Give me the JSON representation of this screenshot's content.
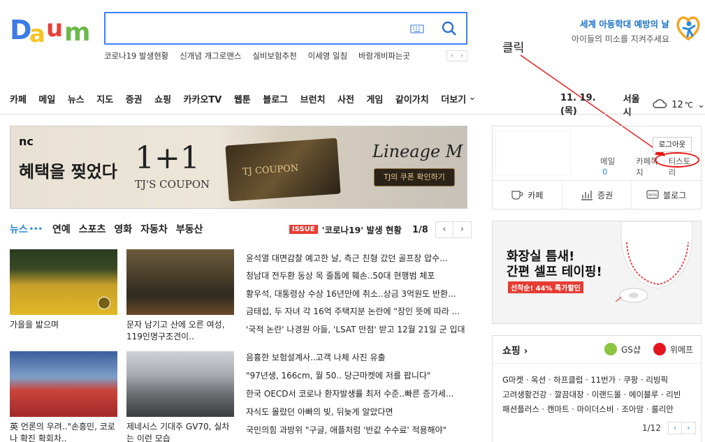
{
  "header": {
    "logo_alt": "Daum",
    "search": {
      "value": "",
      "placeholder": ""
    },
    "trending": [
      "코로나19 발생현황",
      "신개념 개그로맨스",
      "실비보험추천",
      "이세영 일침",
      "바람개비파는곳"
    ],
    "trend_prev": "‹",
    "trend_next": "›",
    "campaign": {
      "line1": "세계 아동학대 예방의 날",
      "line2": "아이들의 미소를 지켜주세요"
    }
  },
  "annotation": {
    "text": "클릭"
  },
  "nav": {
    "items": [
      "카페",
      "메일",
      "뉴스",
      "지도",
      "증권",
      "쇼핑",
      "카카오TV",
      "웹툰",
      "블로그",
      "브런치",
      "사전",
      "게임",
      "같이가치",
      "더보기"
    ],
    "date": "11. 19. (목)",
    "city": "서울시",
    "temp": "12",
    "temp_unit": "℃"
  },
  "ad": {
    "brand": "nc",
    "headline": "혜택을 찢었다",
    "big": "1+1",
    "sub": "TJ'S COUPON",
    "coupon": "TJ COUPON",
    "game": "Lineage M",
    "cta": "TJ의 쿠폰 확인하기"
  },
  "news": {
    "tabs": [
      "뉴스",
      "연예",
      "스포츠",
      "영화",
      "자동차",
      "부동산"
    ],
    "issue_badge": "ISSUE",
    "issue_text": "'코로나19' 발생 현황",
    "page": "1/8",
    "thumbs": [
      {
        "caption": "가을을 밟으며"
      },
      {
        "caption": "문자 남기고 산에 오른 여성, 119인명구조견이.."
      },
      {
        "caption": "英 언론의 우려..\"손흥민, 코로나 확진 확회차.."
      },
      {
        "caption": "제네시스 기대주 GV70, 실차는 이런 모습"
      }
    ],
    "headlines": [
      "윤석열 대면감찰 예고한 날, 측근 친형 갔던 골프장 압수...",
      "청남대 전두환 동상 목 줄톱에 훼손..50대 현행범 체포",
      "황우석, 대통령상 수상 16년만에 취소..상금 3억원도 반환...",
      "금태섭, 두 자녀 각 16억 주택지분 논란에 \"장인 뜻에 따라 ...",
      "'국적 논란' 나경원 아들, 'LSAT 만점' 받고 12월 21일 군 입대"
    ],
    "headlines2": [
      "음흉한 보험설계사..고객 나체 사진 유출",
      "\"97년생, 166cm, 월 50.. 당근마켓에 저를 팝니다\"",
      "한국 OECD서 코로나 환자발생률 최저 수준..빠른 증가세...",
      "자식도 몰랐던 아빠의 빚, 뒤늦게 알았다면",
      "국민의힘 과방위 \"구글, 애플처럼 '반값 수수료' 적용해야\""
    ]
  },
  "login": {
    "logout": "로그아웃",
    "mail_label": "메일",
    "mail_count": "0",
    "cafe_note": "카페쪽지",
    "tistory": "티스토리",
    "services": [
      "카페",
      "증권",
      "블로그"
    ]
  },
  "right_ad": {
    "line1": "화장실 틈새!",
    "line2": "간편 셀프 테이핑!",
    "sale": "선착순! 44% 특가할인"
  },
  "shopping": {
    "title": "쇼핑 ›",
    "partners": [
      "GS샵",
      "위메프"
    ],
    "links_row1": "G마켓 · 옥션 · 하프클럽 · 11번가 · 쿠팡 · 리빙픽",
    "links_row2": "고려생활건강 · 깔끔대장 · 이랜드몰 · 에이블루 · 리빈",
    "links_row3": "패션플러스 · 캔마트 · 마이더스비 · 조아맘 · 룰리안",
    "page": "1/12"
  },
  "colors": {
    "accent": "#2a8adf",
    "annotation": "#e11111",
    "search_border": "#3b82f6"
  }
}
